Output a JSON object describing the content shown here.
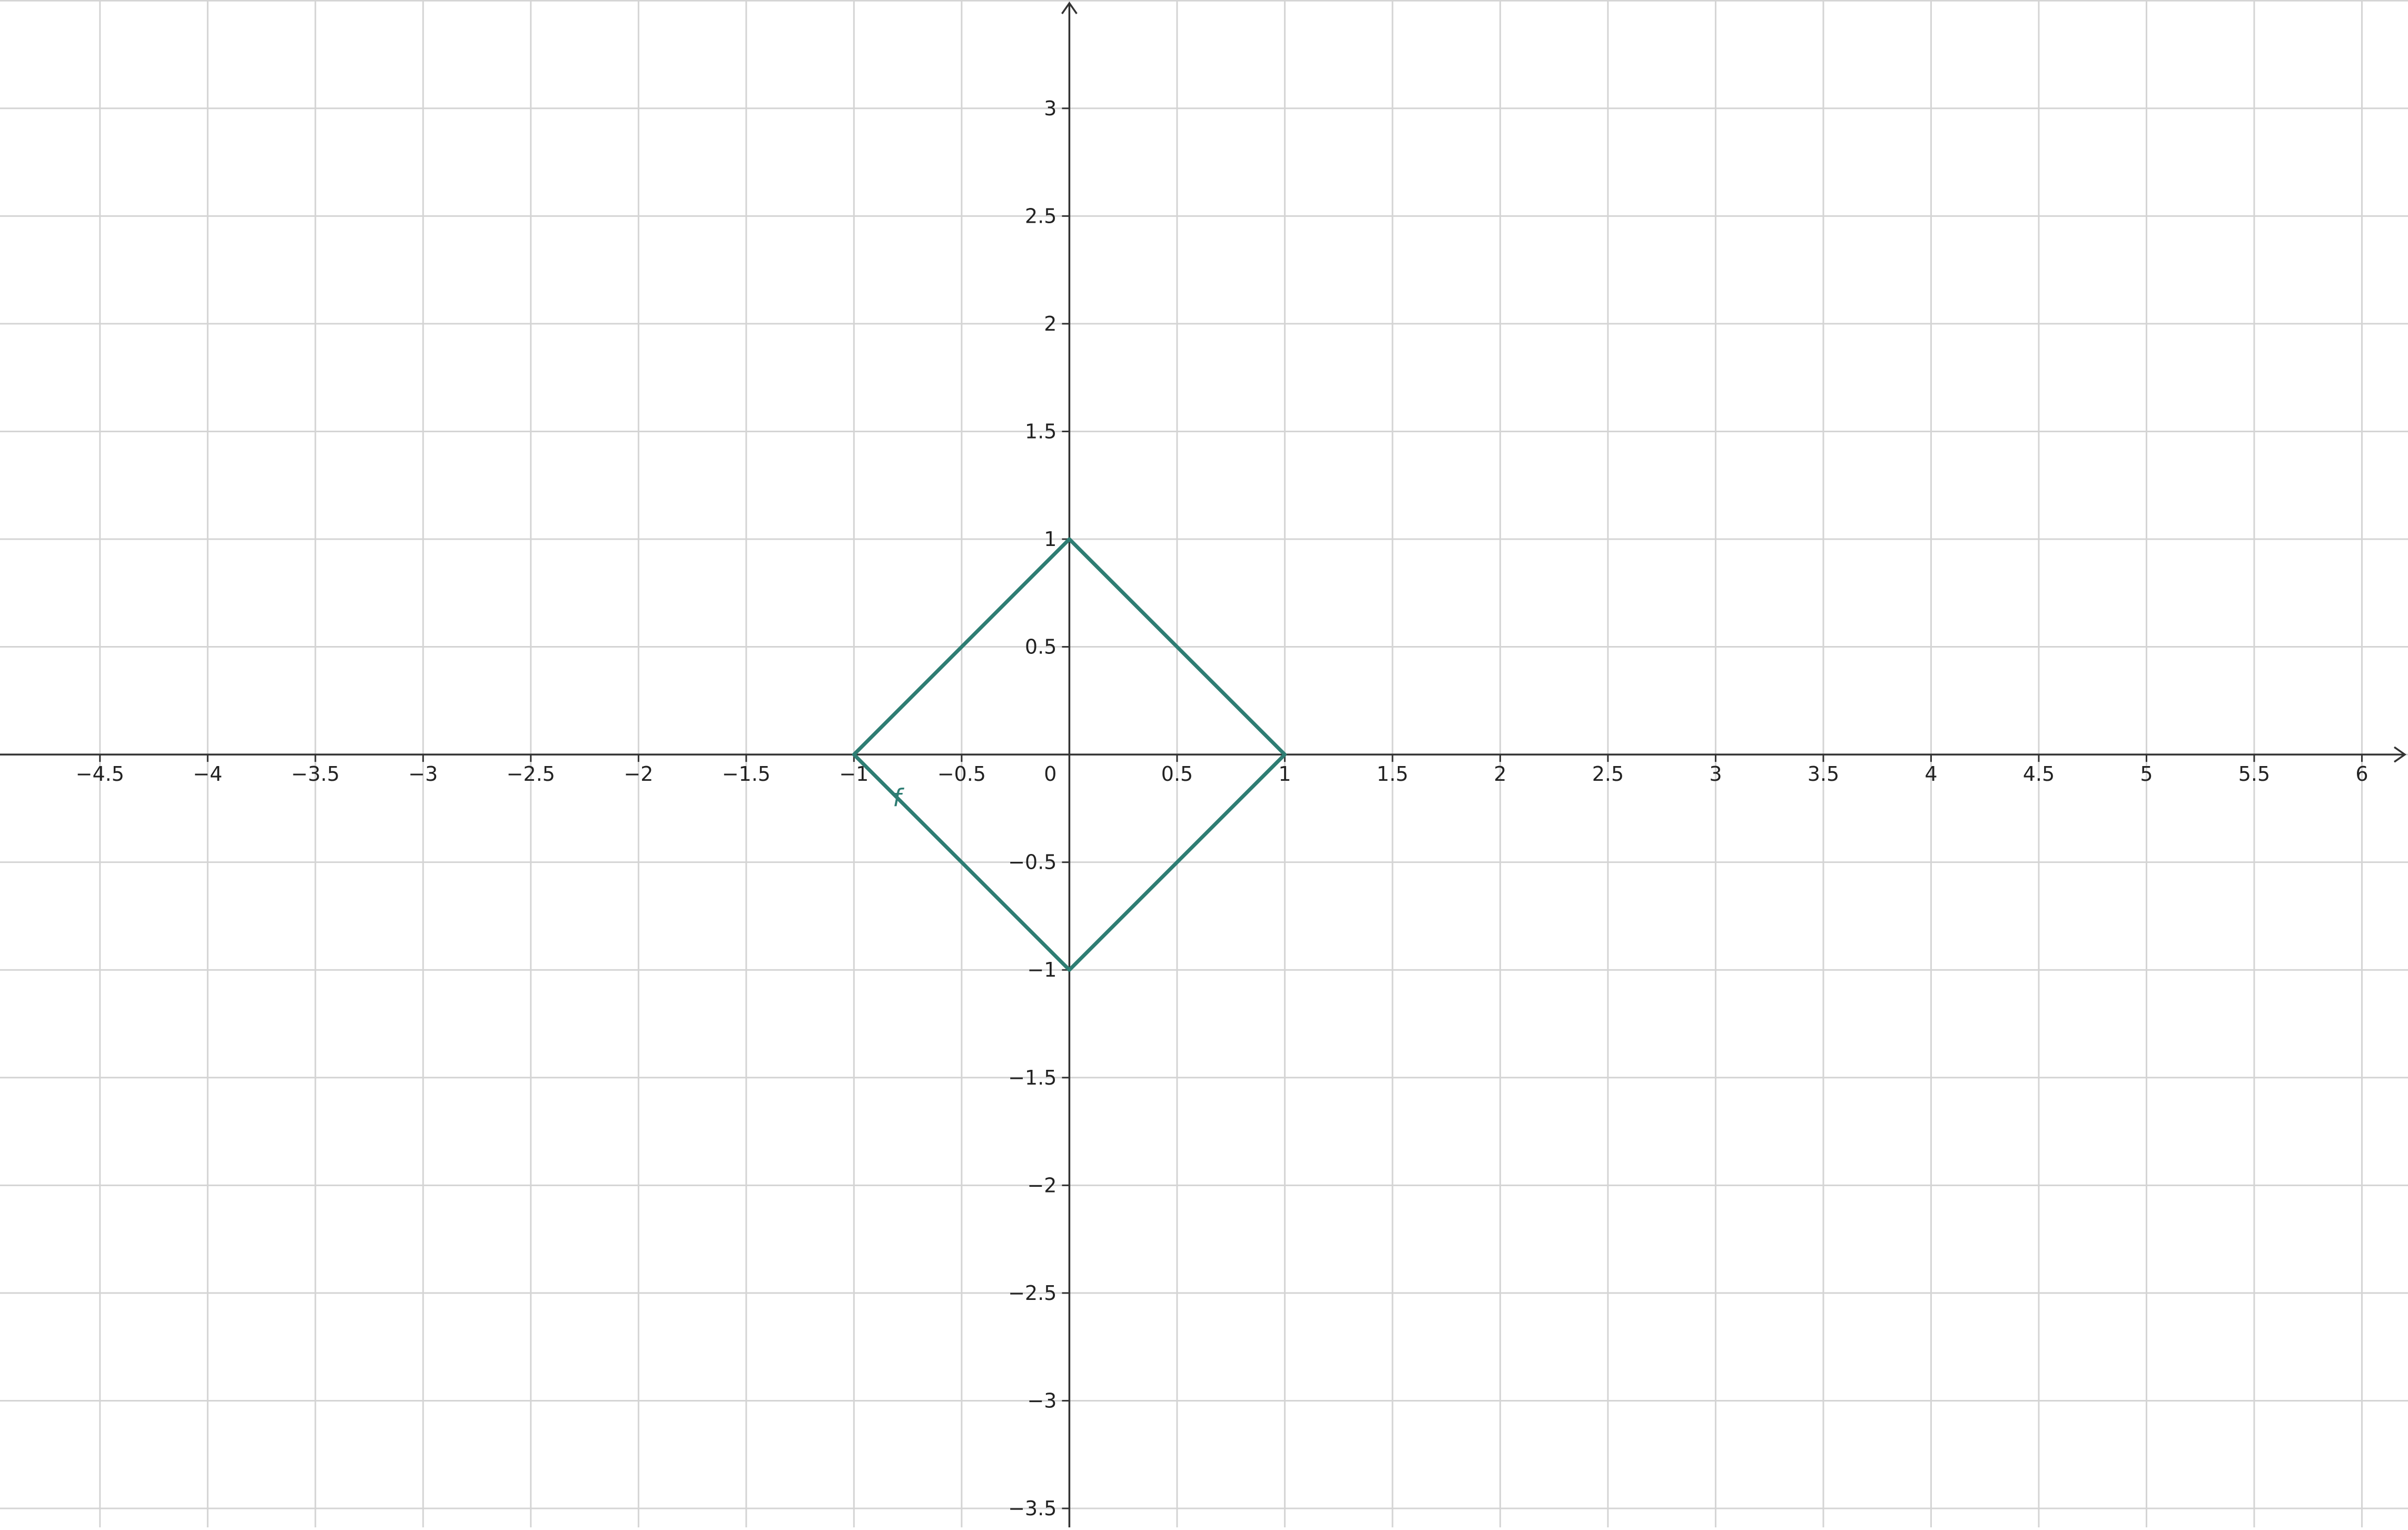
{
  "chart_data": {
    "type": "line",
    "title": "",
    "xlabel": "",
    "ylabel": "",
    "xlim": [
      -4.964,
      6.214
    ],
    "ylim": [
      -3.588,
      3.503
    ],
    "grid": true,
    "grid_step": 0.5,
    "x_ticks": [
      -4.5,
      -4,
      -3.5,
      -3,
      -2.5,
      -2,
      -1.5,
      -1,
      -0.5,
      0.5,
      1,
      1.5,
      2,
      2.5,
      3,
      3.5,
      4,
      4.5,
      5,
      5.5,
      6
    ],
    "x_tick_labels": [
      "−4.5",
      "−4",
      "−3.5",
      "−3",
      "−2.5",
      "−2",
      "−1.5",
      "−1",
      "−0.5",
      "0.5",
      "1",
      "1.5",
      "2",
      "2.5",
      "3",
      "3.5",
      "4",
      "4.5",
      "5",
      "5.5",
      "6"
    ],
    "y_ticks": [
      3,
      2.5,
      2,
      1.5,
      1,
      0.5,
      -0.5,
      -1,
      -1.5,
      -2,
      -2.5,
      -3,
      -3.5
    ],
    "y_tick_labels": [
      "3",
      "2.5",
      "2",
      "1.5",
      "1",
      "0.5",
      "−0.5",
      "−1",
      "−1.5",
      "−2",
      "−2.5",
      "−3",
      "−3.5"
    ],
    "origin_label": "0",
    "series": [
      {
        "name": "f",
        "color": "#2e7d73",
        "x": [
          -1,
          0,
          1,
          0,
          -1
        ],
        "y": [
          0,
          1,
          0,
          -1,
          0
        ]
      }
    ],
    "annotations": [
      {
        "text": "f",
        "x": -0.8,
        "y": -0.24
      }
    ]
  },
  "colors": {
    "grid": "#d4d4d4",
    "axis": "#333333",
    "curve": "#2e7d73",
    "background": "#ffffff"
  }
}
